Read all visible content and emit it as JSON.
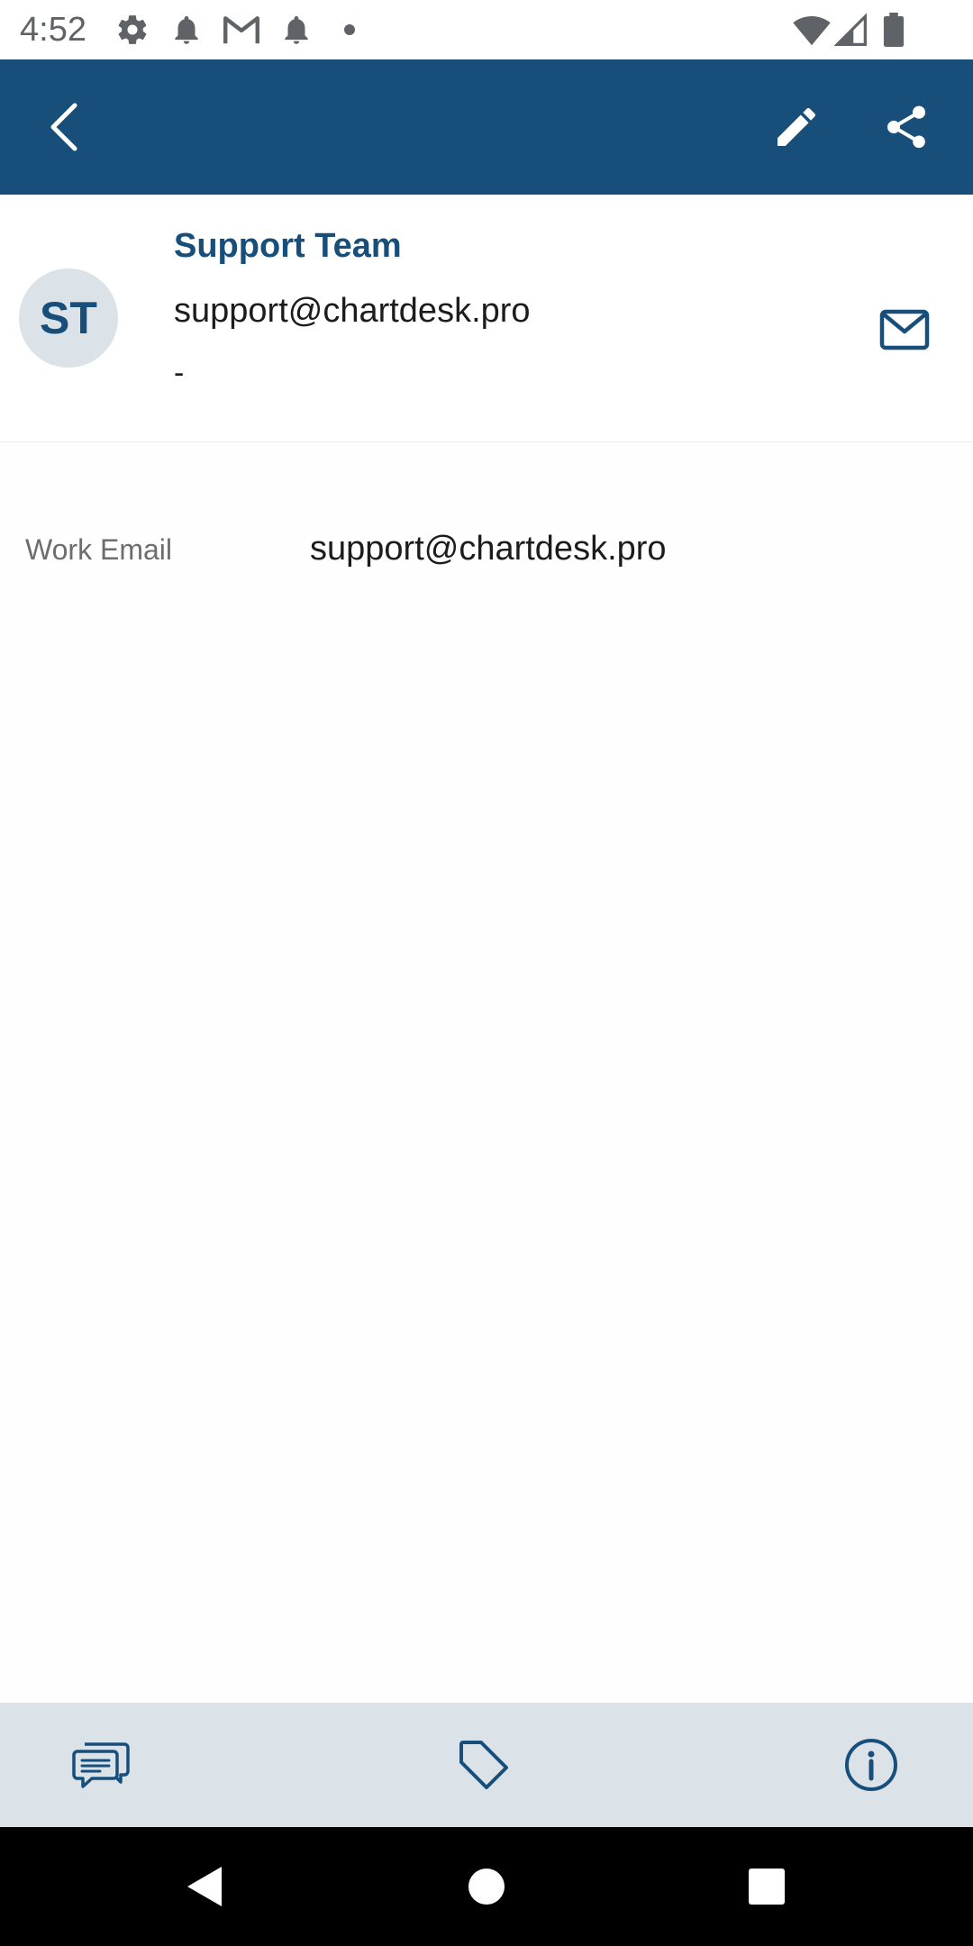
{
  "colors": {
    "primary": "#174e7a",
    "avatar_bg": "#dbe3e9",
    "toolbar_bg": "#dbe3e9",
    "status_text": "#5f6368"
  },
  "status_bar": {
    "time": "4:52",
    "icons": [
      "gear-icon",
      "notification-bell-icon",
      "gmail-icon",
      "notification-bell-icon",
      "dot-icon",
      "wifi-icon",
      "cell-signal-icon",
      "battery-icon"
    ]
  },
  "app_bar": {
    "icons": [
      "back-chevron-icon",
      "edit-pencil-icon",
      "share-icon"
    ]
  },
  "contact": {
    "initials": "ST",
    "name": "Support Team",
    "email": "support@chartdesk.pro",
    "extra": "-"
  },
  "details": [
    {
      "label": "Work Email",
      "value": "support@chartdesk.pro"
    }
  ],
  "bottom_toolbar": {
    "icons": [
      "conversations-icon",
      "tag-icon",
      "info-icon"
    ]
  },
  "nav_bar": {
    "icons": [
      "nav-back-icon",
      "nav-home-icon",
      "nav-recents-icon"
    ]
  }
}
